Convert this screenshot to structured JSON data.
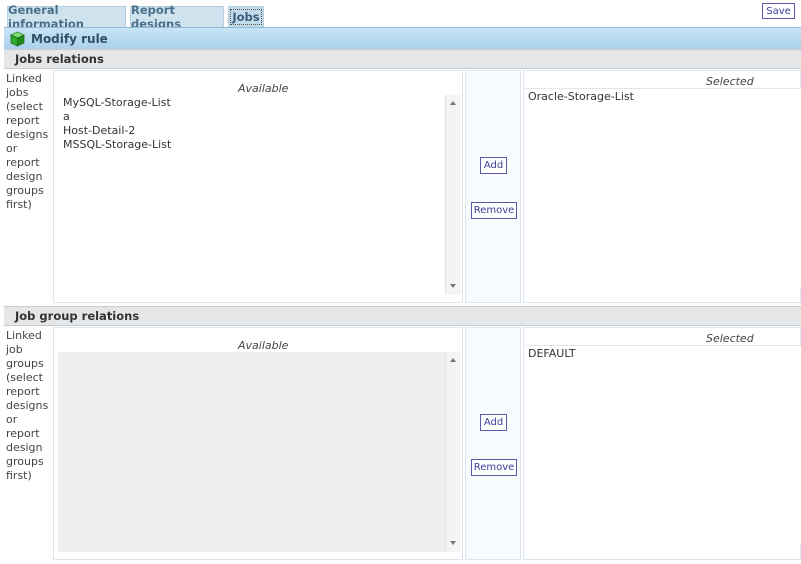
{
  "tabs": [
    {
      "label": "General information",
      "active": false
    },
    {
      "label": "Report designs",
      "active": false
    },
    {
      "label": "Jobs",
      "active": true
    }
  ],
  "toolbar": {
    "save_label": "Save"
  },
  "rule": {
    "title": "Modify rule",
    "icon": "green-cube-icon"
  },
  "jobs_relations": {
    "section_title": "Jobs relations",
    "side_label": "Linked jobs (select report designs or report design groups first)",
    "available_header": "Available",
    "selected_header": "Selected",
    "available_items": [
      "MySQL-Storage-List",
      "a",
      "Host-Detail-2",
      "MSSQL-Storage-List"
    ],
    "selected_items": [
      "Oracle-Storage-List"
    ],
    "add_label": "Add",
    "remove_label": "Remove"
  },
  "job_group_relations": {
    "section_title": "Job group relations",
    "side_label": "Linked job groups (select report designs or report design groups first)",
    "available_header": "Available",
    "selected_header": "Selected",
    "available_items": [],
    "selected_items": [
      "DEFAULT"
    ],
    "add_label": "Add",
    "remove_label": "Remove"
  }
}
